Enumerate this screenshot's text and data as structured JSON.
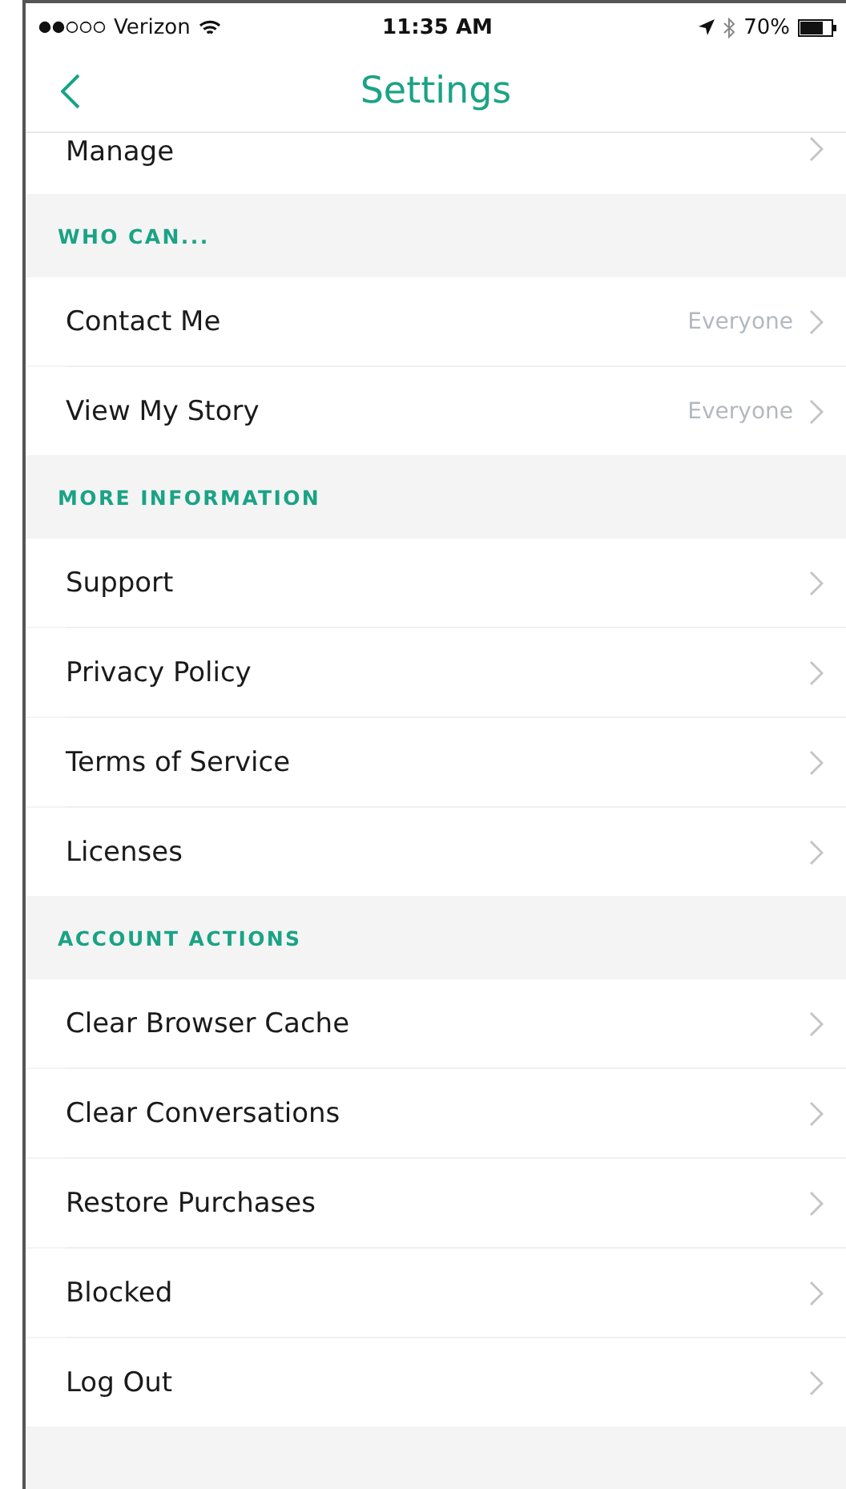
{
  "status_bar": {
    "carrier": "Verizon",
    "time": "11:35 AM",
    "battery": "70%"
  },
  "nav_bar": {
    "title": "Settings"
  },
  "sections": [
    {
      "rows": [
        {
          "label": "Manage",
          "cut": true
        }
      ]
    },
    {
      "header": "WHO CAN...",
      "rows": [
        {
          "label": "Contact Me",
          "value": "Everyone"
        },
        {
          "label": "View My Story",
          "value": "Everyone"
        }
      ]
    },
    {
      "header": "MORE INFORMATION",
      "rows": [
        {
          "label": "Support"
        },
        {
          "label": "Privacy Policy"
        },
        {
          "label": "Terms of Service"
        },
        {
          "label": "Licenses"
        }
      ]
    },
    {
      "header": "ACCOUNT ACTIONS",
      "rows": [
        {
          "label": "Clear Browser Cache"
        },
        {
          "label": "Clear Conversations"
        },
        {
          "label": "Restore Purchases"
        },
        {
          "label": "Blocked"
        },
        {
          "label": "Log Out"
        }
      ]
    }
  ]
}
